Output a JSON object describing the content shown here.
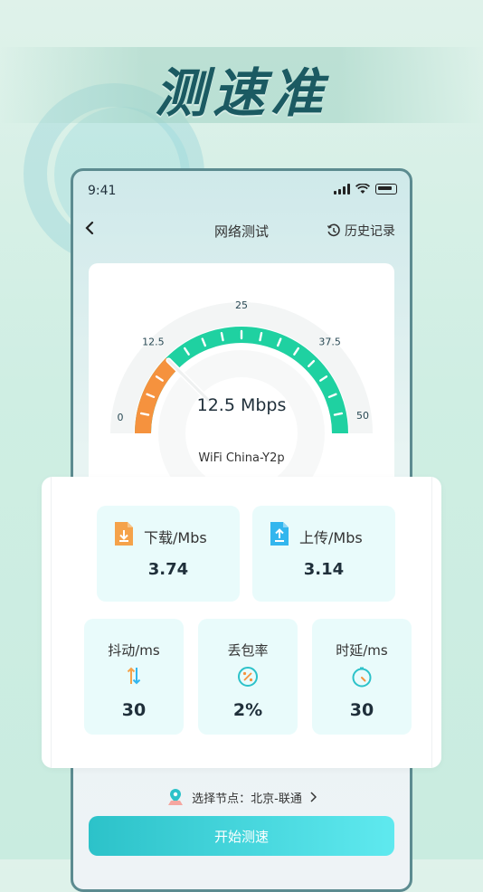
{
  "promo": {
    "title": "测速准"
  },
  "status_bar": {
    "time": "9:41"
  },
  "nav": {
    "title": "网络测试",
    "history_label": "历史记录"
  },
  "gauge": {
    "speed_text": "12.5 Mbps",
    "value": 12.5,
    "min": 0,
    "max": 50,
    "tick_labels": [
      "0",
      "12.5",
      "25",
      "37.5",
      "50"
    ],
    "network": "WiFi  China-Y2p",
    "colors": {
      "track": "#1fd1a1",
      "active": "#f5923e"
    }
  },
  "stats": {
    "download": {
      "label": "下载/Mbs",
      "value": "3.74",
      "icon": "download-file-icon"
    },
    "upload": {
      "label": "上传/Mbs",
      "value": "3.14",
      "icon": "upload-file-icon"
    },
    "jitter": {
      "label": "抖动/ms",
      "value": "30",
      "icon": "jitter-arrows-icon"
    },
    "packet_loss": {
      "label": "丢包率",
      "value": "2%",
      "icon": "percent-icon"
    },
    "latency": {
      "label": "时延/ms",
      "value": "30",
      "icon": "timer-icon"
    }
  },
  "node": {
    "label": "选择节点：北京-联通"
  },
  "action": {
    "start_label": "开始测速"
  },
  "colors": {
    "accent": "#2cc2c9",
    "title": "#1b5a62"
  }
}
